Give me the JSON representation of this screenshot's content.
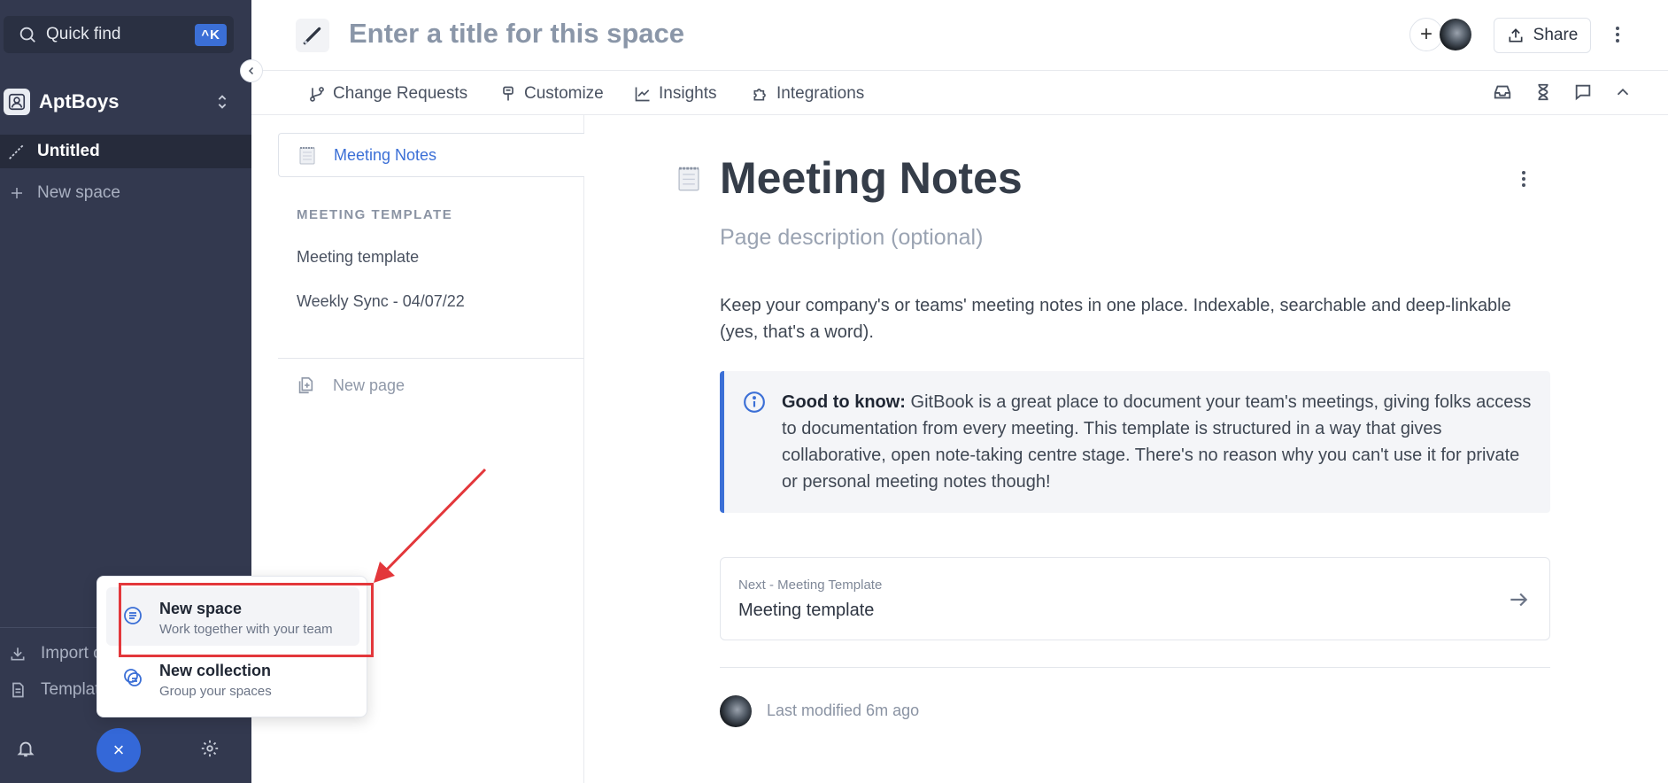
{
  "sidebar": {
    "search": {
      "label": "Quick find",
      "shortcut": "^K"
    },
    "org_name": "AptBoys",
    "spaces": [
      {
        "label": "Untitled"
      },
      {
        "label": "New space"
      }
    ],
    "bottom_links": [
      {
        "label": "Import c"
      },
      {
        "label": "Templat"
      }
    ],
    "fab_symbol": "×"
  },
  "popup_menu": {
    "items": [
      {
        "title": "New space",
        "subtitle": "Work together with your team",
        "icon": "space-icon"
      },
      {
        "title": "New collection",
        "subtitle": "Group your spaces",
        "icon": "collection-icon"
      }
    ]
  },
  "header": {
    "title_placeholder": "Enter a title for this space",
    "share_label": "Share",
    "tabs": [
      {
        "label": "Change Requests",
        "icon": "branch-icon"
      },
      {
        "label": "Customize",
        "icon": "paintbrush-icon"
      },
      {
        "label": "Insights",
        "icon": "trend-icon"
      },
      {
        "label": "Integrations",
        "icon": "puzzle-icon"
      }
    ]
  },
  "page_tree": {
    "selected": "Meeting Notes",
    "group_heading": "MEETING TEMPLATE",
    "items": [
      {
        "label": "Meeting template"
      },
      {
        "label": "Weekly Sync - 04/07/22"
      }
    ],
    "new_page_label": "New page"
  },
  "document": {
    "title": "Meeting Notes",
    "description_placeholder": "Page description (optional)",
    "body": "Keep your company's or teams' meeting notes in one place. Indexable, searchable and deep-linkable (yes, that's a word).",
    "callout": {
      "bold": "Good to know:",
      "text": " GitBook is a great place to document your team's meetings, giving folks access to documentation from every meeting. This template is structured in a way that gives collaborative, open note-taking centre stage. There's no reason why you can't use it for private or personal meeting notes though!"
    },
    "next": {
      "label": "Next - Meeting Template",
      "title": "Meeting template"
    },
    "last_modified": "Last modified 6m ago"
  },
  "colors": {
    "sidebar_bg": "#33394f",
    "accent": "#3b6fd6",
    "highlight": "#e3373b"
  }
}
